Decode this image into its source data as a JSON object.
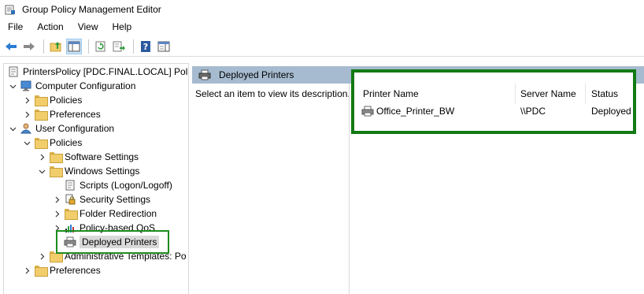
{
  "window": {
    "title": "Group Policy Management Editor"
  },
  "menu": [
    "File",
    "Action",
    "View",
    "Help"
  ],
  "tree": {
    "root": "PrintersPolicy [PDC.FINAL.LOCAL] Polic",
    "computer_config": "Computer Configuration",
    "cc_policies": "Policies",
    "cc_preferences": "Preferences",
    "user_config": "User Configuration",
    "uc_policies": "Policies",
    "software_settings": "Software Settings",
    "windows_settings": "Windows Settings",
    "scripts": "Scripts (Logon/Logoff)",
    "security_settings": "Security Settings",
    "folder_redirection": "Folder Redirection",
    "policy_qos": "Policy-based QoS",
    "deployed_printers": "Deployed Printers",
    "admin_templates": "Administrative Templates: Po",
    "uc_preferences": "Preferences"
  },
  "details": {
    "header": "Deployed Printers",
    "description": "Select an item to view its description.",
    "columns": [
      "Printer Name",
      "Server Name",
      "Status"
    ],
    "rows": [
      {
        "printer": "Office_Printer_BW",
        "server": "\\\\PDC",
        "status": "Deployed"
      }
    ]
  },
  "colors": {
    "highlight": "#137a13",
    "header_bg": "#a6bbcf",
    "selection": "#d9d9d9"
  }
}
